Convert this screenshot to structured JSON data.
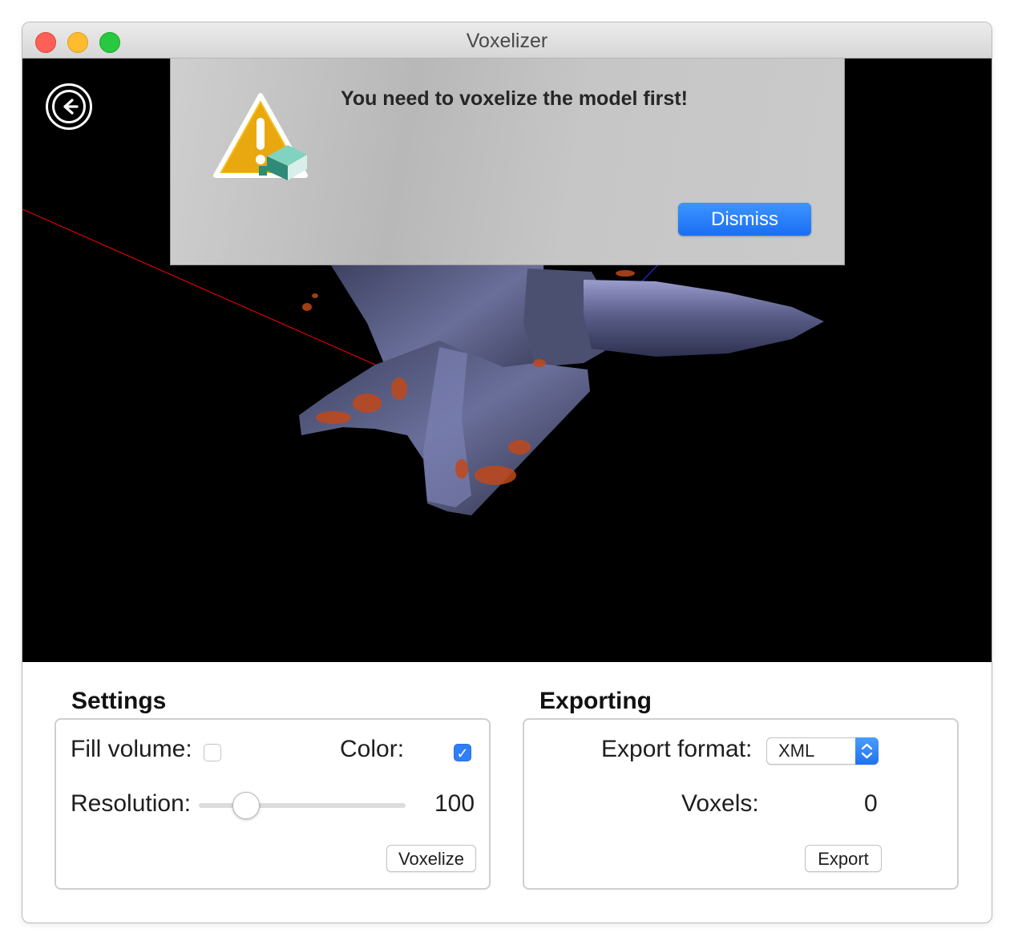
{
  "window": {
    "title": "Voxelizer"
  },
  "alert": {
    "message": "You need to voxelize the model first!",
    "dismiss_label": "Dismiss"
  },
  "settings": {
    "title": "Settings",
    "fill_volume_label": "Fill volume:",
    "fill_volume_checked": false,
    "color_label": "Color:",
    "color_checked": true,
    "resolution_label": "Resolution:",
    "resolution_value": "100",
    "voxelize_label": "Voxelize"
  },
  "exporting": {
    "title": "Exporting",
    "export_format_label": "Export format:",
    "export_format_value": "XML",
    "voxels_label": "Voxels:",
    "voxels_value": "0",
    "export_label": "Export"
  },
  "colors": {
    "accent": "#1a6ef5",
    "viewport_bg": "#000000",
    "anvil_metal": "#5a5f86",
    "rust": "#c0481b",
    "axis_x": "#ff0000"
  }
}
